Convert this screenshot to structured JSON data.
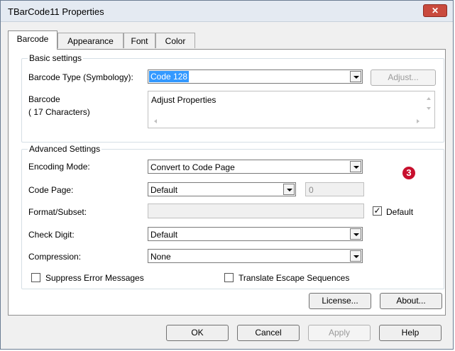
{
  "window": {
    "title": "TBarCode11 Properties",
    "close_glyph": "✕"
  },
  "tabs": [
    {
      "label": "Barcode"
    },
    {
      "label": "Appearance"
    },
    {
      "label": "Font"
    },
    {
      "label": "Color"
    }
  ],
  "basic": {
    "legend": "Basic settings",
    "type_label": "Barcode Type (Symbology):",
    "type_value": "Code 128",
    "adjust_label": "Adjust...",
    "barcode_label": "Barcode",
    "chars_label": "(      17 Characters)",
    "barcode_text": "Adjust Properties"
  },
  "advanced": {
    "legend": "Advanced Settings",
    "encoding_label": "Encoding Mode:",
    "encoding_value": "Convert to Code Page",
    "codepage_label": "Code Page:",
    "codepage_value": "Default",
    "codepage_number": "0",
    "format_label": "Format/Subset:",
    "format_default_label": "Default",
    "checkdigit_label": "Check Digit:",
    "checkdigit_value": "Default",
    "compression_label": "Compression:",
    "compression_value": "None",
    "suppress_label": "Suppress Error Messages",
    "translate_label": "Translate Escape Sequences",
    "badge": "3"
  },
  "panel_buttons": {
    "license": "License...",
    "about": "About..."
  },
  "footer": {
    "ok": "OK",
    "cancel": "Cancel",
    "apply": "Apply",
    "help": "Help"
  },
  "colors": {
    "selection": "#3399ff",
    "badge": "#c8102e",
    "close": "#c94a3e"
  }
}
